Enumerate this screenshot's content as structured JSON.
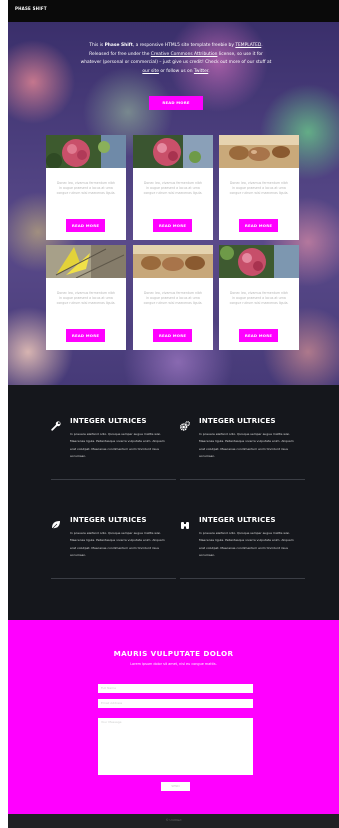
{
  "header": {
    "brand": "PHASE SHIFT"
  },
  "hero": {
    "line1_pre": "This is ",
    "line1_bold": "Phase Shift",
    "line1_post": ", a responsive HTML5 site template freebie by ",
    "line1_link": "TEMPLATED",
    "line1_end": ".",
    "line2_pre": "Released for free under the ",
    "line2_link": "Creative Commons Attribution",
    "line2_post": " license, so use it for",
    "line3": "whatever (personal or commercial) – just give us credit! Check out more of our stuff at",
    "line4_link1": "our site",
    "line4_mid": " or follow us on ",
    "line4_link2": "Twitter",
    "line4_end": ".",
    "button": "READ MORE"
  },
  "cards": [
    {
      "image": "flower-image",
      "text": "Donec leo, vivamus fermentum nibh in augue praesent a lacus at urna congue rutrum wisi maecenas ligula.",
      "button": "READ MORE"
    },
    {
      "image": "flower-image",
      "text": "Donec leo, vivamus fermentum nibh in augue praesent a lacus at urna congue rutrum wisi maecenas ligula.",
      "button": "READ MORE"
    },
    {
      "image": "shells-image",
      "text": "Donec leo, vivamus fermentum nibh in augue praesent a lacus at urna congue rutrum wisi maecenas ligula.",
      "button": "READ MORE"
    },
    {
      "image": "leaf-image",
      "text": "Donec leo, vivamus fermentum nibh in augue praesent a lacus at urna congue rutrum wisi maecenas ligula.",
      "button": "READ MORE"
    },
    {
      "image": "shells-image",
      "text": "Donec leo, vivamus fermentum nibh in augue praesent a lacus at urna congue rutrum wisi maecenas ligula.",
      "button": "READ MORE"
    },
    {
      "image": "flower-image",
      "text": "Donec leo, vivamus fermentum nibh in augue praesent a lacus at urna congue rutrum wisi maecenas ligula.",
      "button": "READ MORE"
    }
  ],
  "features": [
    {
      "icon": "wrench-icon",
      "title": "INTEGER ULTRICES",
      "text": "In posuere eleifend odio. Quisque semper augue mattis wisi. Maecenas ligula. Pellentesque viverra vulputate enim. Aliquam erat volutpat. Maecenas condimentum enim tincidunt risus accumsan."
    },
    {
      "icon": "gears-icon",
      "title": "INTEGER ULTRICES",
      "text": "In posuere eleifend odio. Quisque semper augue mattis wisi. Maecenas ligula. Pellentesque viverra vulputate enim. Aliquam erat volutpat. Maecenas condimentum enim tincidunt risus accumsan."
    },
    {
      "icon": "leaf-icon",
      "title": "INTEGER ULTRICES",
      "text": "In posuere eleifend odio. Quisque semper augue mattis wisi. Maecenas ligula. Pellentesque viverra vulputate enim. Aliquam erat volutpat. Maecenas condimentum enim tincidunt risus accumsan."
    },
    {
      "icon": "binoculars-icon",
      "title": "INTEGER ULTRICES",
      "text": "In posuere eleifend odio. Quisque semper augue mattis wisi. Maecenas ligula. Pellentesque viverra vulputate enim. Aliquam erat volutpat. Maecenas condimentum enim tincidunt risus accumsan."
    }
  ],
  "contact": {
    "title": "MAURIS VULPUTATE DOLOR",
    "subtitle": "Lorem ipsum dolor sit amet, nisl eu congue mattis.",
    "name_placeholder": "Full Name",
    "email_placeholder": "Email Address",
    "message_placeholder": "Your Message",
    "send": "SEND"
  },
  "footer": {
    "text": "© Untitled"
  },
  "colors": {
    "accent": "#ff00ff",
    "dark": "#15171c",
    "topbar": "#0a0a0a"
  }
}
